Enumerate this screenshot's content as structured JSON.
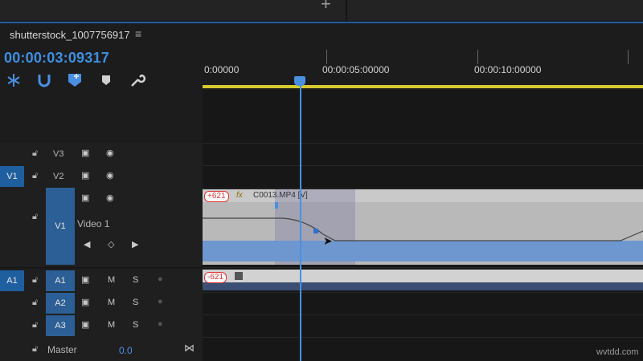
{
  "sequence": {
    "tab_name": "shutterstock_1007756917",
    "menu_icon": "hamburger-icon",
    "timecode": "00:00:03:09317"
  },
  "tools": [
    "snap-icon",
    "linked-selection-icon",
    "add-marker-icon",
    "marker-icon",
    "wrench-icon"
  ],
  "ruler": {
    "labels": [
      "0:00000",
      "00:00:05:00000",
      "00:00:10:00000"
    ]
  },
  "tracks": {
    "video": [
      {
        "name": "V3",
        "source": "",
        "label": ""
      },
      {
        "name": "V2",
        "source": "V1",
        "label": ""
      },
      {
        "name": "V1",
        "source": "",
        "label": "Video 1"
      }
    ],
    "audio": [
      {
        "name": "A1",
        "source": "A1",
        "m": "M",
        "s": "S"
      },
      {
        "name": "A2",
        "source": "",
        "m": "M",
        "s": "S"
      },
      {
        "name": "A3",
        "source": "",
        "m": "M",
        "s": "S"
      }
    ],
    "master": {
      "label": "Master",
      "value": "0.0"
    }
  },
  "clips": {
    "video": {
      "badge": "+621",
      "fx": "fx",
      "name": "C0013.MP4 [V]"
    },
    "audio": {
      "badge": "-621"
    }
  },
  "colors": {
    "accent": "#3d8fe0",
    "target_blue": "#1f5fa0",
    "work_area": "#d6c92e",
    "playhead": "#4a90e2"
  },
  "watermark": "wvtdd.com"
}
